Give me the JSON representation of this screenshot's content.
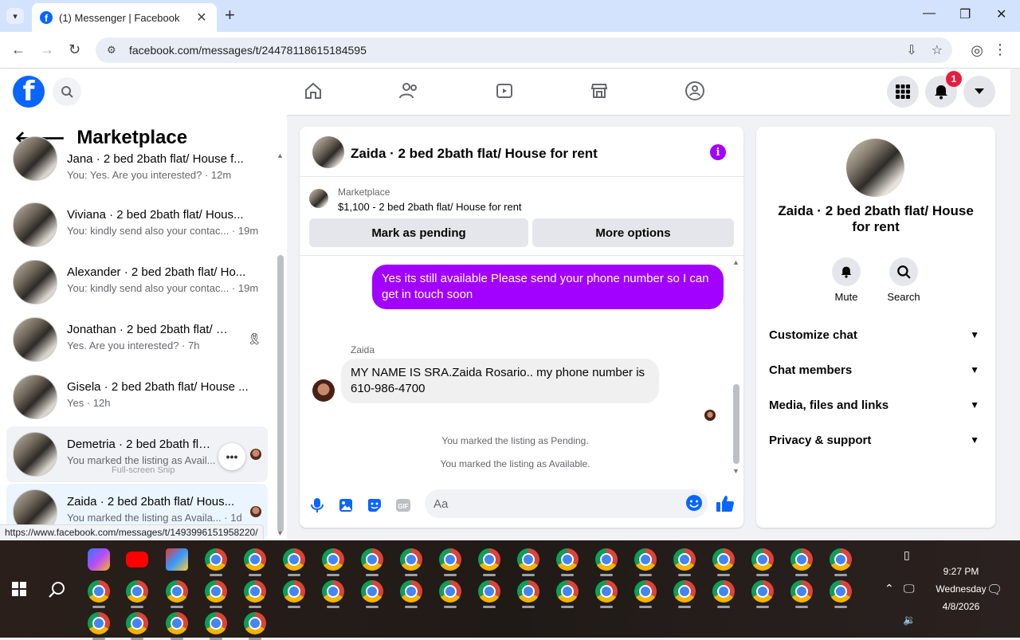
{
  "browser": {
    "tab_title": "(1) Messenger | Facebook",
    "url": "facebook.com/messages/t/24478118615184595",
    "status_url": "https://www.facebook.com/messages/t/1493996151958220/"
  },
  "fb_nav": {
    "notification_count": "1"
  },
  "left": {
    "header": "Marketplace",
    "conversations": [
      {
        "name": "Jana · 2 bed 2bath flat/ House f...",
        "snippet": "You: Yes. Are you interested? · 12m"
      },
      {
        "name": "Viviana · 2 bed 2bath flat/ Hous...",
        "snippet": "You: kindly send also your contac... · 19m"
      },
      {
        "name": "Alexander · 2 bed 2bath flat/ Ho...",
        "snippet": "You: kindly send also your contac... · 19m"
      },
      {
        "name": "Jonathan · 2 bed 2bath flat/ H...",
        "snippet": "Yes. Are you interested? · 7h"
      },
      {
        "name": "Gisela · 2 bed 2bath flat/ House ...",
        "snippet": "Yes · 12h"
      },
      {
        "name": "Demetria · 2 bed 2bath flat/ H...",
        "snippet": "You marked the listing as Avail..."
      },
      {
        "name": "Zaida · 2 bed 2bath flat/ Hous...",
        "snippet": "You marked the listing as Availa... · 1d"
      }
    ],
    "ghost_text": "Full-screen Snip"
  },
  "chat": {
    "title": "Zaida · 2 bed 2bath flat/ House for rent",
    "listing_source": "Marketplace",
    "listing_price": "$1,100 - 2 bed 2bath flat/ House for rent",
    "mark_pending": "Mark as pending",
    "more_options": "More options",
    "outgoing_message": "Yes its still available Please send your phone number so I can get in touch soon",
    "sender_name": "Zaida",
    "incoming_message": "MY NAME IS SRA.Zaida Rosario.. my phone number is 610-986-4700",
    "system_1": "You marked the listing as Pending.",
    "system_2": "You marked the listing as Available.",
    "composer_placeholder": "Aa"
  },
  "right": {
    "name": "Zaida · 2 bed 2bath flat/ House for rent",
    "mute": "Mute",
    "search": "Search",
    "rows": [
      "Customize chat",
      "Chat members",
      "Media, files and links",
      "Privacy & support"
    ]
  },
  "taskbar": {
    "time": "9:27 PM",
    "day": "Wednesday",
    "date": "4/8/2026"
  },
  "colors": {
    "accent": "#a200ff",
    "fb_blue": "#0866ff",
    "badge_red": "#e41e3f"
  }
}
